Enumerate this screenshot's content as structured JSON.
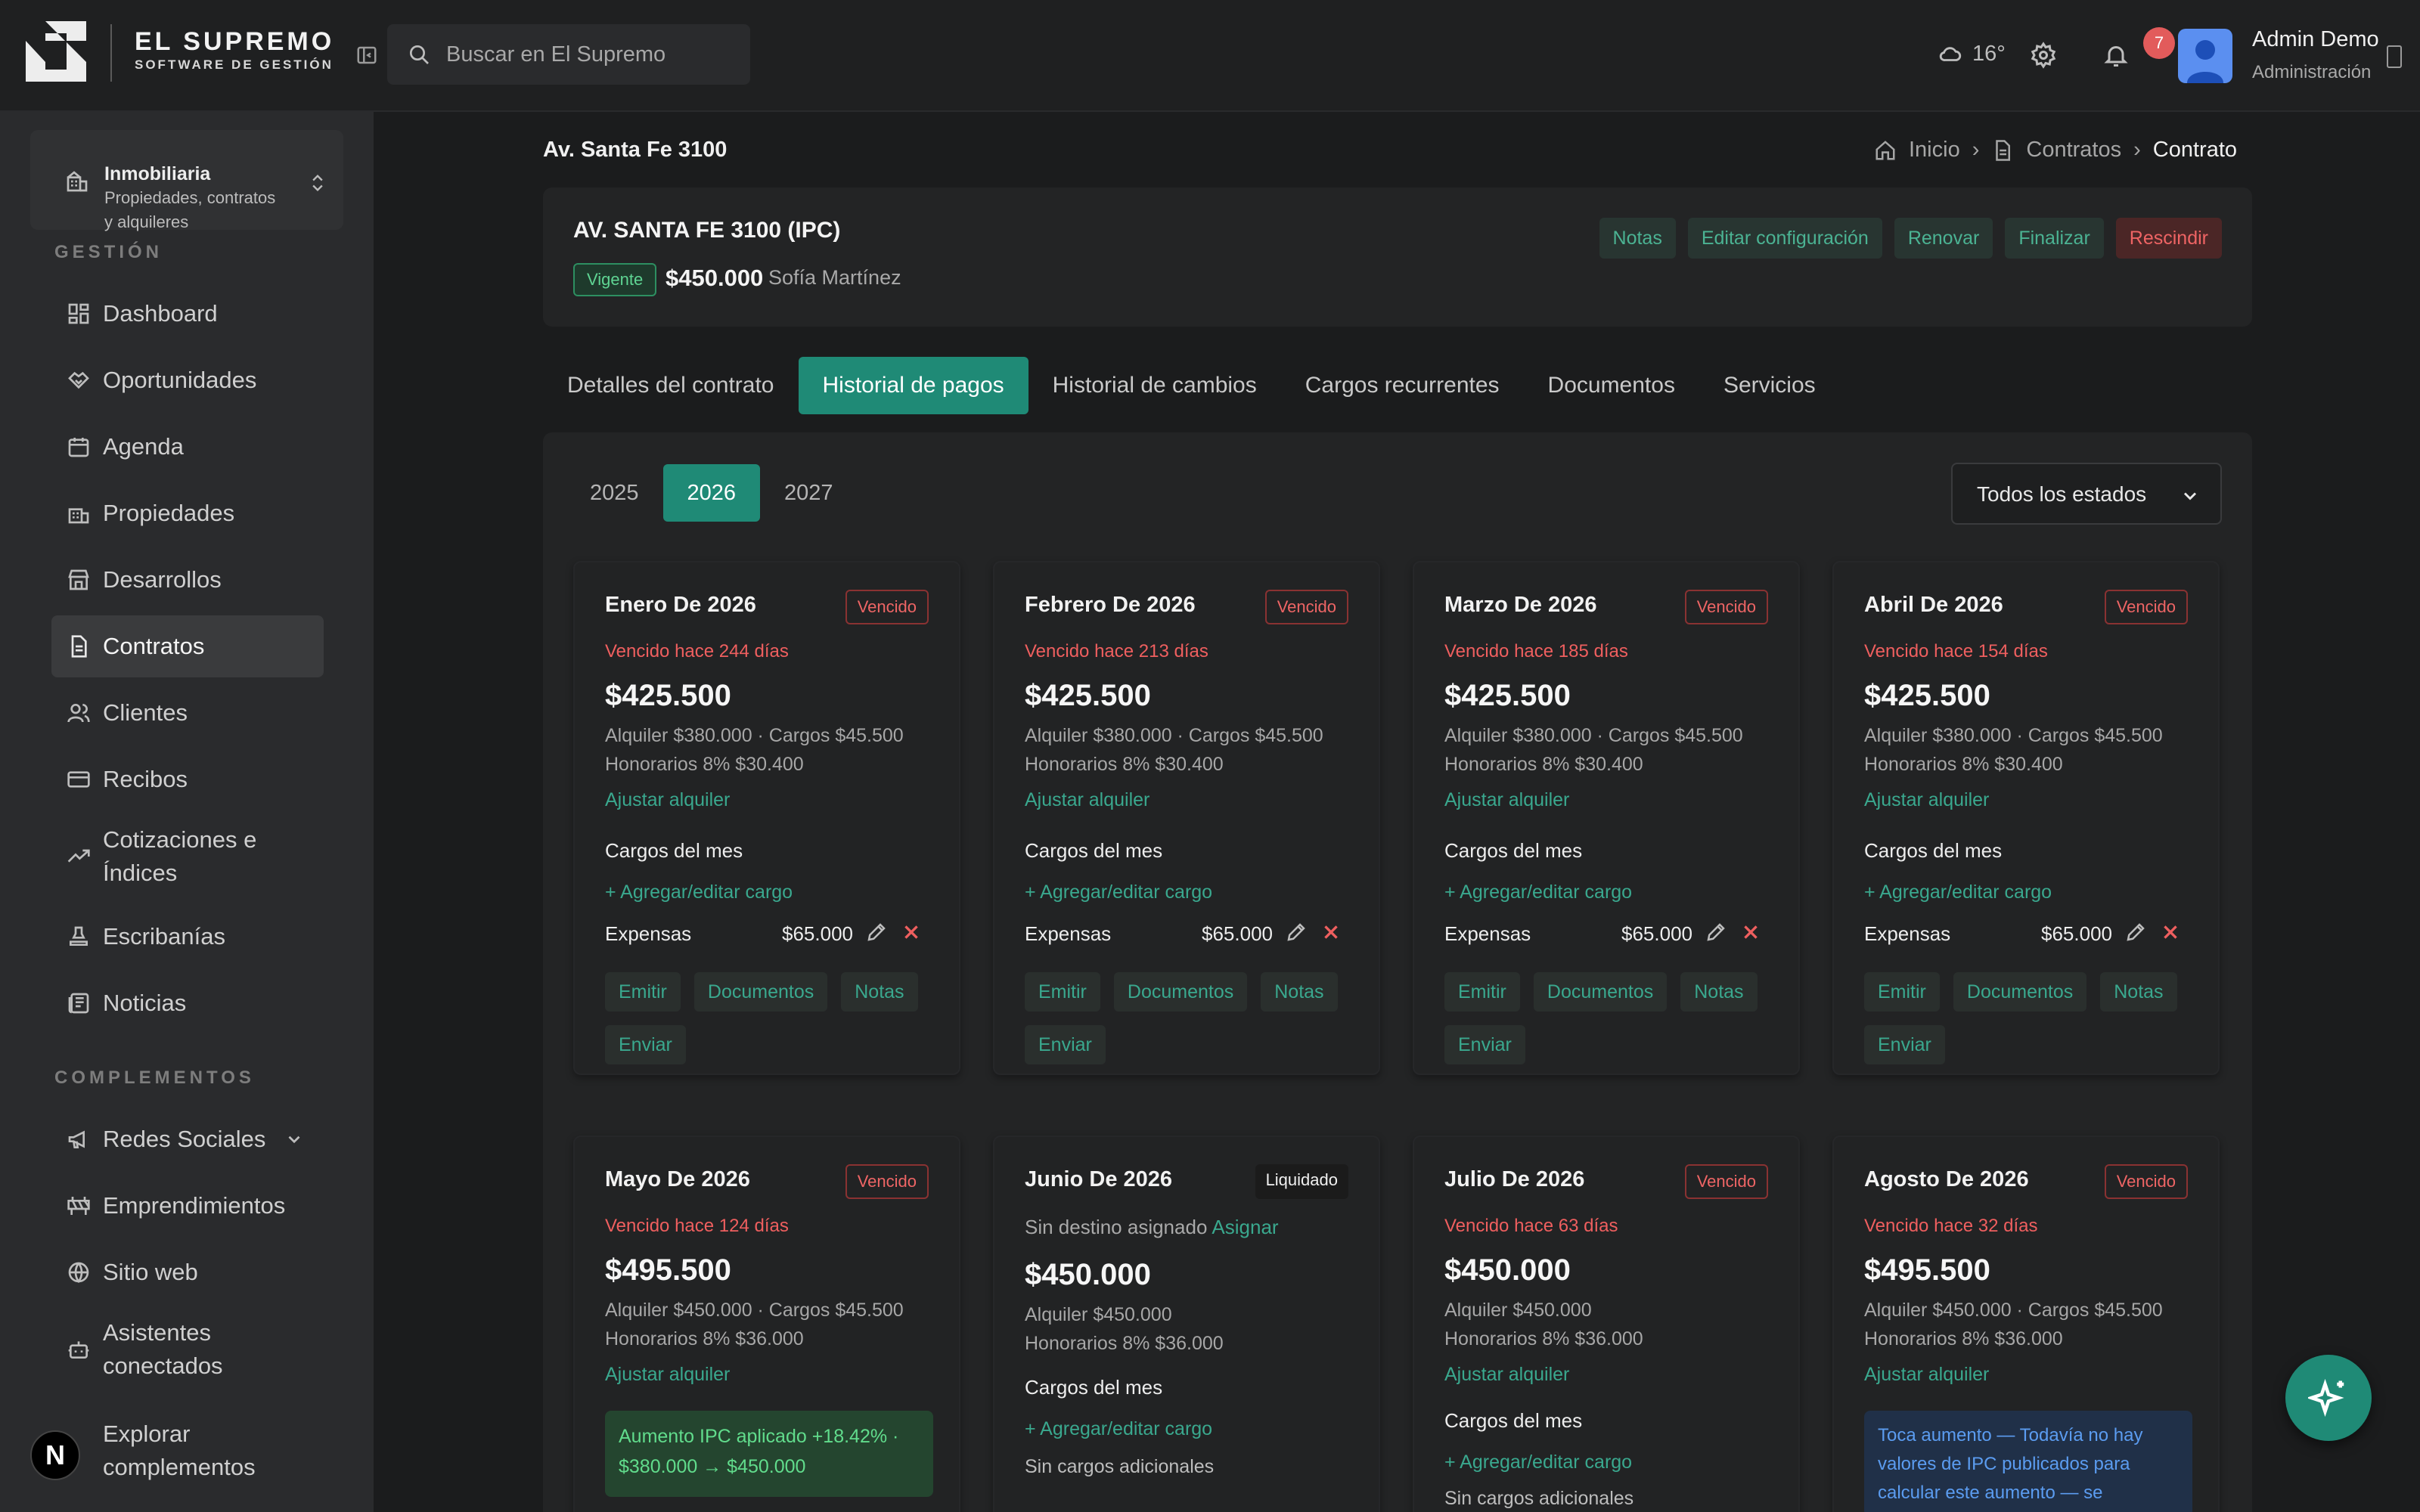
{
  "brand": {
    "title": "EL SUPREMO",
    "subtitle": "SOFTWARE DE GESTIÓN"
  },
  "search": {
    "placeholder": "Buscar en El Supremo"
  },
  "header": {
    "weather": "16°",
    "notifications": "7",
    "user_name": "Admin Demo",
    "user_role": "Administración"
  },
  "org": {
    "name": "Inmobiliaria",
    "description": "Propiedades, contratos y alquileres"
  },
  "sidebar": {
    "section_gestion": "GESTIÓN",
    "section_complementos": "COMPLEMENTOS",
    "items": [
      {
        "label": "Dashboard",
        "icon": "dashboard-icon"
      },
      {
        "label": "Oportunidades",
        "icon": "handshake-icon"
      },
      {
        "label": "Agenda",
        "icon": "calendar-icon"
      },
      {
        "label": "Propiedades",
        "icon": "building-icon"
      },
      {
        "label": "Desarrollos",
        "icon": "store-icon"
      },
      {
        "label": "Contratos",
        "icon": "file-icon",
        "active": true
      },
      {
        "label": "Clientes",
        "icon": "users-icon"
      },
      {
        "label": "Recibos",
        "icon": "card-icon"
      },
      {
        "label": "Cotizaciones e Índices",
        "icon": "trend-icon"
      },
      {
        "label": "Escribanías",
        "icon": "stamp-icon"
      },
      {
        "label": "Noticias",
        "icon": "newspaper-icon"
      }
    ],
    "complementos": [
      {
        "label": "Redes Sociales",
        "icon": "megaphone-icon"
      },
      {
        "label": "Emprendimientos",
        "icon": "construction-icon"
      },
      {
        "label": "Sitio web",
        "icon": "globe-icon"
      },
      {
        "label": "Asistentes conectados",
        "icon": "bot-icon"
      },
      {
        "label": "Explorar complementos",
        "icon": "grid-icon"
      }
    ]
  },
  "page": {
    "title": "Av. Santa Fe 3100"
  },
  "breadcrumb": {
    "home": "Inicio",
    "contracts": "Contratos",
    "current": "Contrato"
  },
  "contract": {
    "title": "AV. SANTA FE 3100 (IPC)",
    "status": "Vigente",
    "amount": "$450.000",
    "client": "Sofía Martínez",
    "actions": {
      "notes": "Notas",
      "edit": "Editar configuración",
      "renew": "Renovar",
      "finish": "Finalizar",
      "rescind": "Rescindir"
    }
  },
  "tabs": [
    "Detalles del contrato",
    "Historial de pagos",
    "Historial de cambios",
    "Cargos recurrentes",
    "Documentos",
    "Servicios"
  ],
  "years": [
    "2025",
    "2026",
    "2027"
  ],
  "status_filter": "Todos los estados",
  "labels": {
    "adjust": "Ajustar alquiler",
    "month_charges": "Cargos del mes",
    "add_charge": "+ Agregar/editar cargo",
    "no_charges": "Sin cargos adicionales",
    "expense": "Expensas",
    "emit": "Emitir",
    "docs": "Documentos",
    "notes": "Notas",
    "send": "Enviar",
    "no_dest": "Sin destino asignado",
    "assign": "Asignar"
  },
  "months": [
    {
      "name": "Enero De 2026",
      "status": "Vencido",
      "due": "Vencido hace 244 días",
      "amount": "$425.500",
      "line1": "Alquiler $380.000 · Cargos $45.500",
      "line2": "Honorarios 8% $30.400",
      "expense": "$65.000"
    },
    {
      "name": "Febrero De 2026",
      "status": "Vencido",
      "due": "Vencido hace 213 días",
      "amount": "$425.500",
      "line1": "Alquiler $380.000 · Cargos $45.500",
      "line2": "Honorarios 8% $30.400",
      "expense": "$65.000"
    },
    {
      "name": "Marzo De 2026",
      "status": "Vencido",
      "due": "Vencido hace 185 días",
      "amount": "$425.500",
      "line1": "Alquiler $380.000 · Cargos $45.500",
      "line2": "Honorarios 8% $30.400",
      "expense": "$65.000"
    },
    {
      "name": "Abril De 2026",
      "status": "Vencido",
      "due": "Vencido hace 154 días",
      "amount": "$425.500",
      "line1": "Alquiler $380.000 · Cargos $45.500",
      "line2": "Honorarios 8% $30.400",
      "expense": "$65.000"
    },
    {
      "name": "Mayo De 2026",
      "status": "Vencido",
      "due": "Vencido hace 124 días",
      "amount": "$495.500",
      "line1": "Alquiler $450.000 · Cargos $45.500",
      "line2": "Honorarios 8% $36.000",
      "ipc": "Aumento IPC aplicado +18.42% · $380.000 → $450.000"
    },
    {
      "name": "Junio De 2026",
      "status": "Liquidado",
      "amount": "$450.000",
      "line1": "Alquiler $450.000",
      "line2": "Honorarios 8% $36.000"
    },
    {
      "name": "Julio De 2026",
      "status": "Vencido",
      "due": "Vencido hace 63 días",
      "amount": "$450.000",
      "line1": "Alquiler $450.000",
      "line2": "Honorarios 8% $36.000"
    },
    {
      "name": "Agosto De 2026",
      "status": "Vencido",
      "due": "Vencido hace 32 días",
      "amount": "$495.500",
      "line1": "Alquiler $450.000 · Cargos $45.500",
      "line2": "Honorarios 8% $36.000",
      "notice": "Toca aumento — Todavía no hay valores de IPC publicados para calcular este aumento — se"
    }
  ],
  "colors": {
    "accent": "#1f8a76",
    "danger": "#ee6565",
    "success": "#5fd493",
    "background": "#1b1c1d"
  }
}
